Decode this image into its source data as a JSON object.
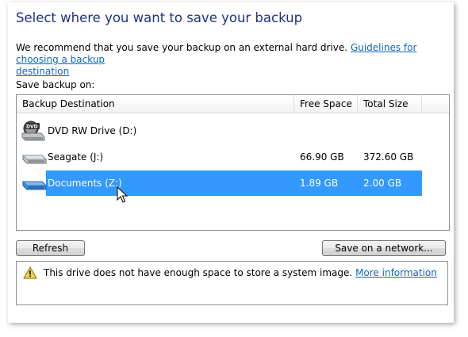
{
  "header": {
    "title": "Select where you want to save your backup"
  },
  "intro": {
    "text": "We recommend that you save your backup on an external hard drive.",
    "link_part1": "Guidelines for choosing a backup",
    "link_part2": "destination"
  },
  "save_on_label": "Save backup on:",
  "table": {
    "columns": [
      "Backup Destination",
      "Free Space",
      "Total Size"
    ],
    "rows": [
      {
        "name": "DVD RW Drive (D:)",
        "free": "",
        "total": "",
        "icon": "dvd-drive-icon",
        "selected": false
      },
      {
        "name": "Seagate (J:)",
        "free": "66.90 GB",
        "total": "372.60 GB",
        "icon": "hard-drive-icon",
        "selected": false
      },
      {
        "name": "Documents (Z:)",
        "free": "1.89 GB",
        "total": "2.00 GB",
        "icon": "network-drive-icon",
        "selected": true
      }
    ],
    "selection_color": "#3399ff"
  },
  "buttons": {
    "refresh": "Refresh",
    "network": "Save on a network..."
  },
  "warning": {
    "icon": "warning-icon",
    "text": "This drive does not have enough space to store a system image.",
    "link": "More information"
  },
  "colors": {
    "title": "#1e3287",
    "link": "#0b66c8"
  }
}
